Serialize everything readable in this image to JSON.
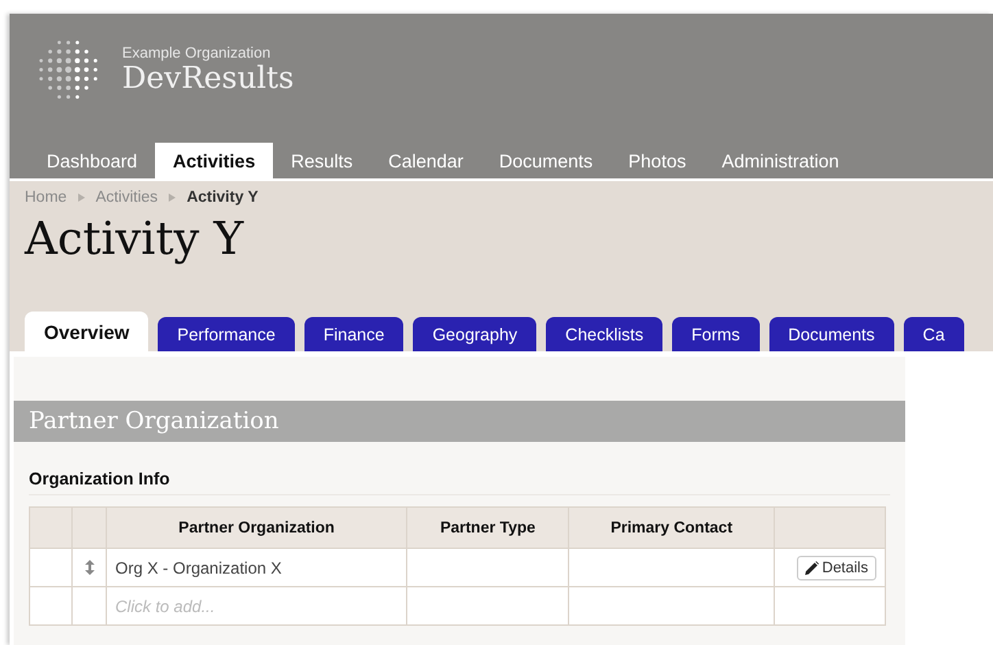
{
  "org": {
    "subtitle": "Example Organization",
    "name": "DevResults"
  },
  "nav": [
    {
      "label": "Dashboard",
      "selected": false
    },
    {
      "label": "Activities",
      "selected": true
    },
    {
      "label": "Results",
      "selected": false
    },
    {
      "label": "Calendar",
      "selected": false
    },
    {
      "label": "Documents",
      "selected": false
    },
    {
      "label": "Photos",
      "selected": false
    },
    {
      "label": "Administration",
      "selected": false
    }
  ],
  "breadcrumb": [
    {
      "label": "Home",
      "current": false
    },
    {
      "label": "Activities",
      "current": false
    },
    {
      "label": "Activity Y",
      "current": true
    }
  ],
  "title": "Activity Y",
  "tabs": [
    {
      "label": "Overview",
      "selected": true
    },
    {
      "label": "Performance",
      "selected": false
    },
    {
      "label": "Finance",
      "selected": false
    },
    {
      "label": "Geography",
      "selected": false
    },
    {
      "label": "Checklists",
      "selected": false
    },
    {
      "label": "Forms",
      "selected": false
    },
    {
      "label": "Documents",
      "selected": false
    },
    {
      "label": "Ca",
      "selected": false
    }
  ],
  "section": {
    "title": "Partner Organization",
    "subtitle": "Organization Info",
    "table": {
      "columns": [
        "Partner Organization",
        "Partner Type",
        "Primary Contact"
      ],
      "rows": [
        {
          "organization": "Org X - Organization X",
          "button": "Details"
        }
      ],
      "add_placeholder": "Click to add..."
    }
  }
}
